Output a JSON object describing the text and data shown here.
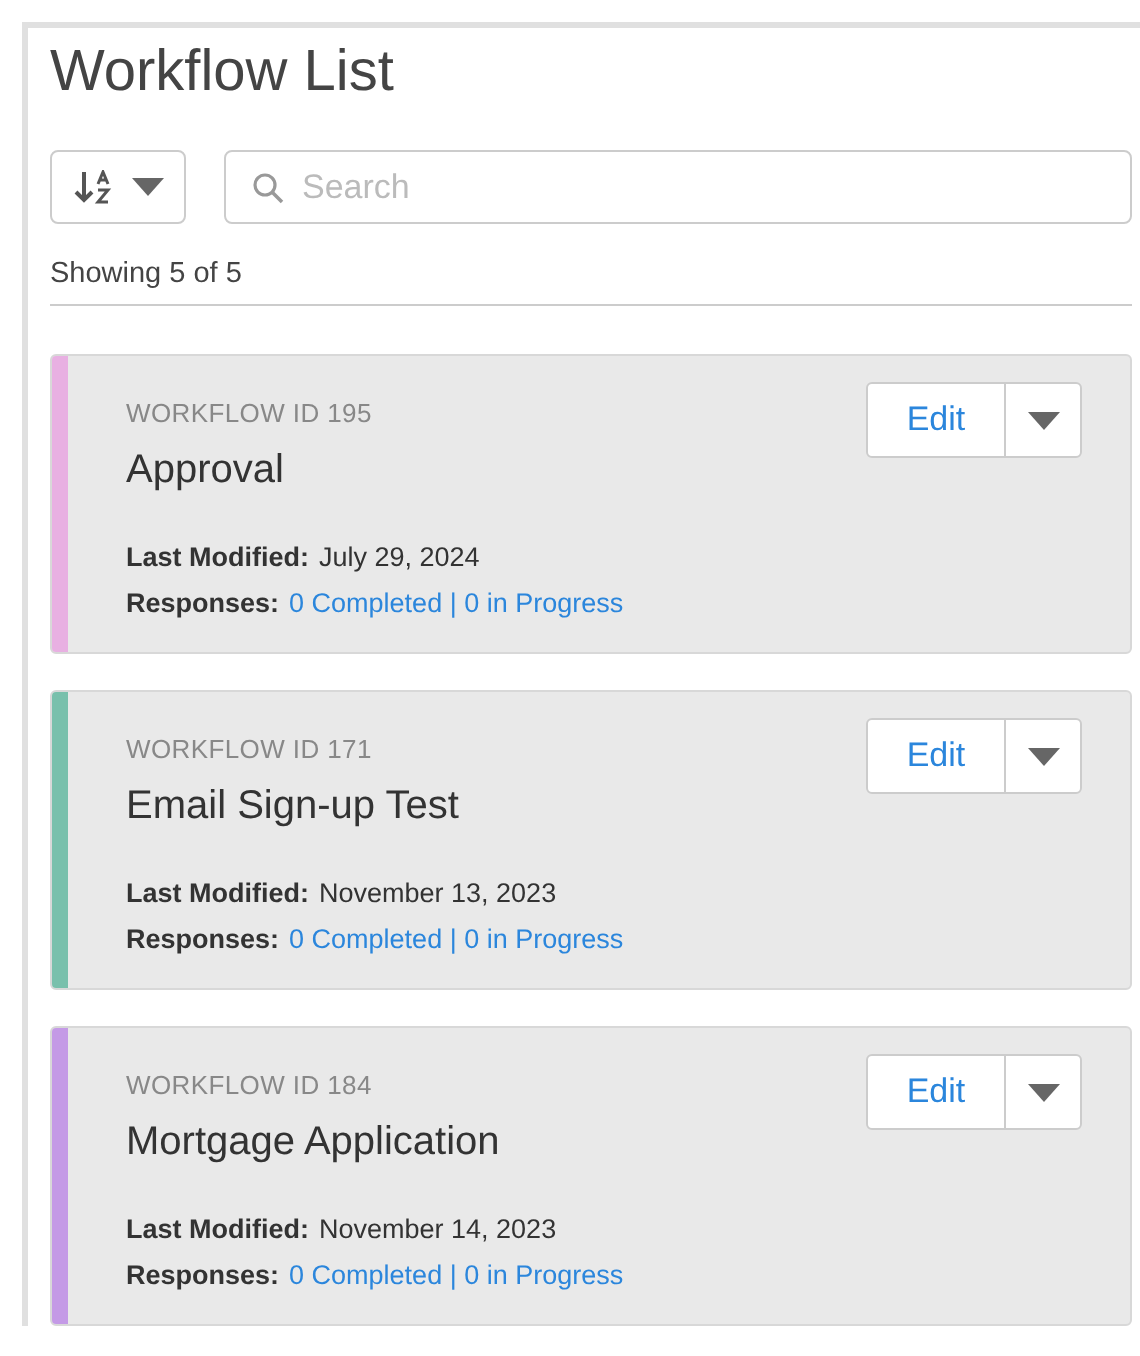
{
  "title": "Workflow List",
  "search": {
    "placeholder": "Search"
  },
  "count_text": "Showing 5 of 5",
  "workflows": [
    {
      "id_label": "WORKFLOW ID 195",
      "name": "Approval",
      "color": "#e8b0e2",
      "modified_label": "Last Modified:",
      "modified": "July 29, 2024",
      "responses_label": "Responses:",
      "responses": "0 Completed | 0 in Progress",
      "edit": "Edit"
    },
    {
      "id_label": "WORKFLOW ID 171",
      "name": "Email Sign-up Test",
      "color": "#79c0ac",
      "modified_label": "Last Modified:",
      "modified": "November 13, 2023",
      "responses_label": "Responses:",
      "responses": "0 Completed | 0 in Progress",
      "edit": "Edit"
    },
    {
      "id_label": "WORKFLOW ID 184",
      "name": "Mortgage Application",
      "color": "#c49ae6",
      "modified_label": "Last Modified:",
      "modified": "November 14, 2023",
      "responses_label": "Responses:",
      "responses": "0 Completed | 0 in Progress",
      "edit": "Edit"
    }
  ]
}
